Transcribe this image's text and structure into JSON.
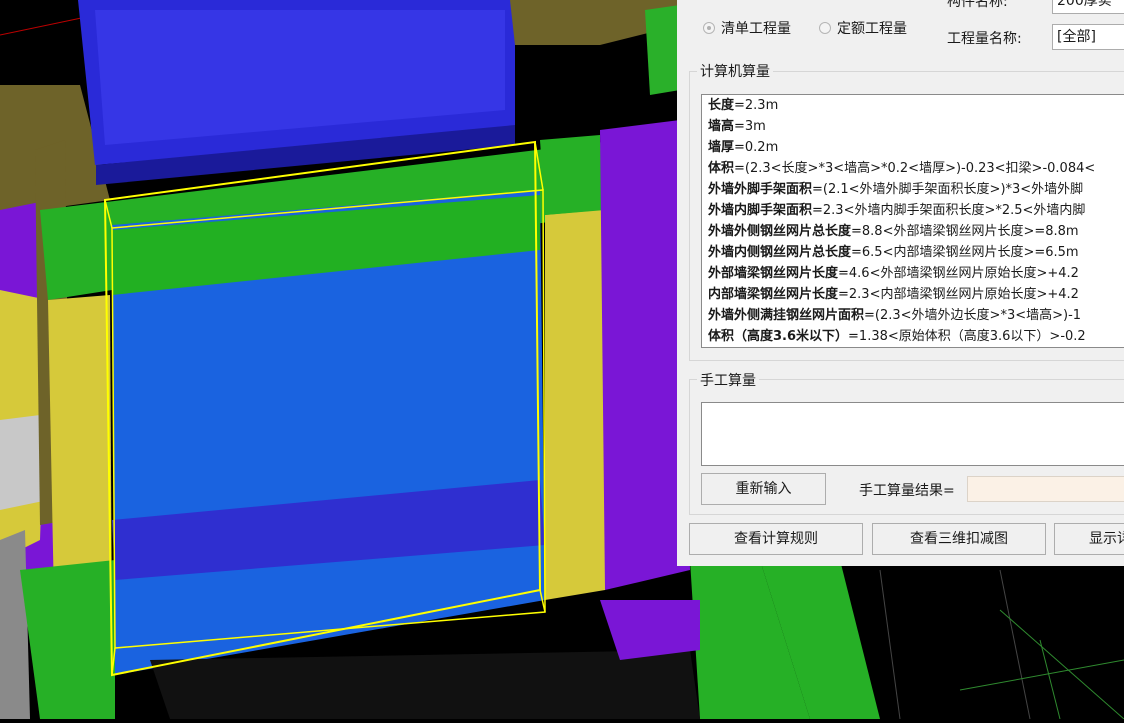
{
  "viewport": {
    "label": "3d-model-view"
  },
  "panel": {
    "top_label_partial": "构件名称:",
    "top_value_partial": "200厚实",
    "radio_options": [
      {
        "label": "清单工程量",
        "selected": true
      },
      {
        "label": "定额工程量",
        "selected": false
      }
    ],
    "quantity_name_label": "工程量名称:",
    "quantity_name_value": "[全部]",
    "computer_group_title": "计算机算量",
    "computer_lines": [
      {
        "name": "长度",
        "formula": "=2.3m"
      },
      {
        "name": "墙高",
        "formula": "=3m"
      },
      {
        "name": "墙厚",
        "formula": "=0.2m"
      },
      {
        "name": "体积",
        "formula": "=(2.3<长度>*3<墙高>*0.2<墙厚>)-0.23<扣梁>-0.084<"
      },
      {
        "name": "外墙外脚手架面积",
        "formula": "=(2.1<外墙外脚手架面积长度>)*3<外墙外脚"
      },
      {
        "name": "外墙内脚手架面积",
        "formula": "=2.3<外墙内脚手架面积长度>*2.5<外墙内脚"
      },
      {
        "name": "外墙外侧钢丝网片总长度",
        "formula": "=8.8<外部墙梁钢丝网片长度>=8.8m"
      },
      {
        "name": "外墙内侧钢丝网片总长度",
        "formula": "=6.5<内部墙梁钢丝网片长度>=6.5m"
      },
      {
        "name": "外部墙梁钢丝网片长度",
        "formula": "=4.6<外部墙梁钢丝网片原始长度>+4.2"
      },
      {
        "name": "内部墙梁钢丝网片长度",
        "formula": "=2.3<内部墙梁钢丝网片原始长度>+4.2"
      },
      {
        "name": "外墙外侧满挂钢丝网片面积",
        "formula": "=(2.3<外墙外边长度>*3<墙高>)-1"
      },
      {
        "name": "体积（高度3.6米以下）",
        "formula": "=1.38<原始体积（高度3.6以下）>-0.2"
      }
    ],
    "manual_group_title": "手工算量",
    "manual_input_value": "",
    "reenter_button": "重新输入",
    "manual_result_label": "手工算量结果=",
    "manual_result_value": "",
    "bottom_buttons": [
      "查看计算规则",
      "查看三维扣减图",
      "显示详"
    ]
  }
}
